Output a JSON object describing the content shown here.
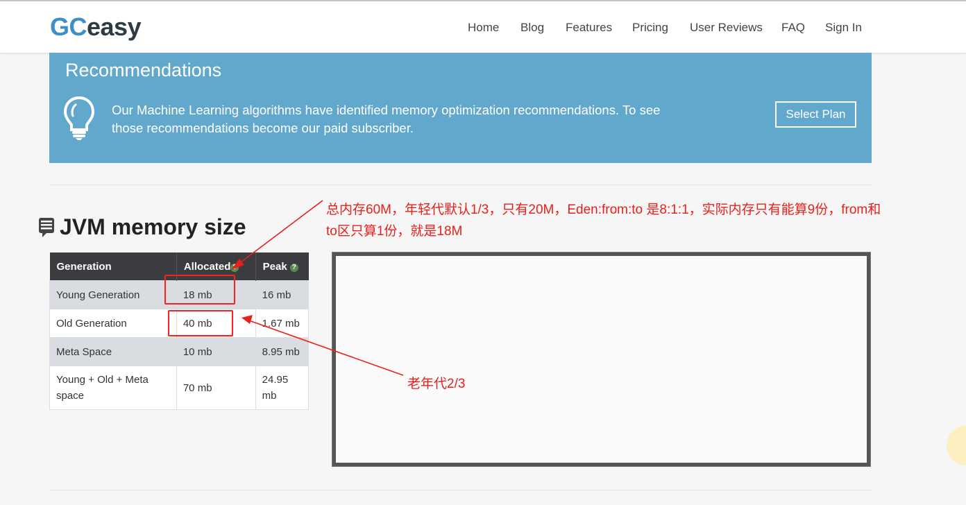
{
  "header": {
    "logo_gc": "GC",
    "logo_easy": "easy",
    "nav": [
      "Home",
      "Blog",
      "Features",
      "Pricing",
      "User Reviews",
      "FAQ",
      "Sign In"
    ]
  },
  "banner": {
    "title": "Recommendations",
    "text_line1": "Our Machine Learning algorithms have identified memory optimization recommendations. To see",
    "text_line2": "those recommendations become our paid subscriber.",
    "button": "Select Plan"
  },
  "section": {
    "title": "JVM memory size"
  },
  "table": {
    "headers": [
      "Generation",
      "Allocated",
      "Peak"
    ],
    "rows": [
      {
        "generation": "Young Generation",
        "allocated": "18 mb",
        "peak": "16 mb"
      },
      {
        "generation": "Old Generation",
        "allocated": "40 mb",
        "peak": "1.67 mb"
      },
      {
        "generation": "Meta Space",
        "allocated": "10 mb",
        "peak": "8.95 mb"
      },
      {
        "generation": "Young + Old + Meta space",
        "allocated": "70 mb",
        "peak": "24.95 mb"
      }
    ]
  },
  "annotations": {
    "top_line1": "总内存60M，年轻代默认1/3，只有20M，Eden:from:to 是8:1:1，实际内存只有能算9份，from和",
    "top_line2": "to区只算1份，就是18M",
    "old_gen": "老年代2/3"
  },
  "colors": {
    "accent": "#3d8fc8",
    "banner": "#62a8cc",
    "table_header": "#3a3c3f",
    "annotation": "#e8201b"
  }
}
